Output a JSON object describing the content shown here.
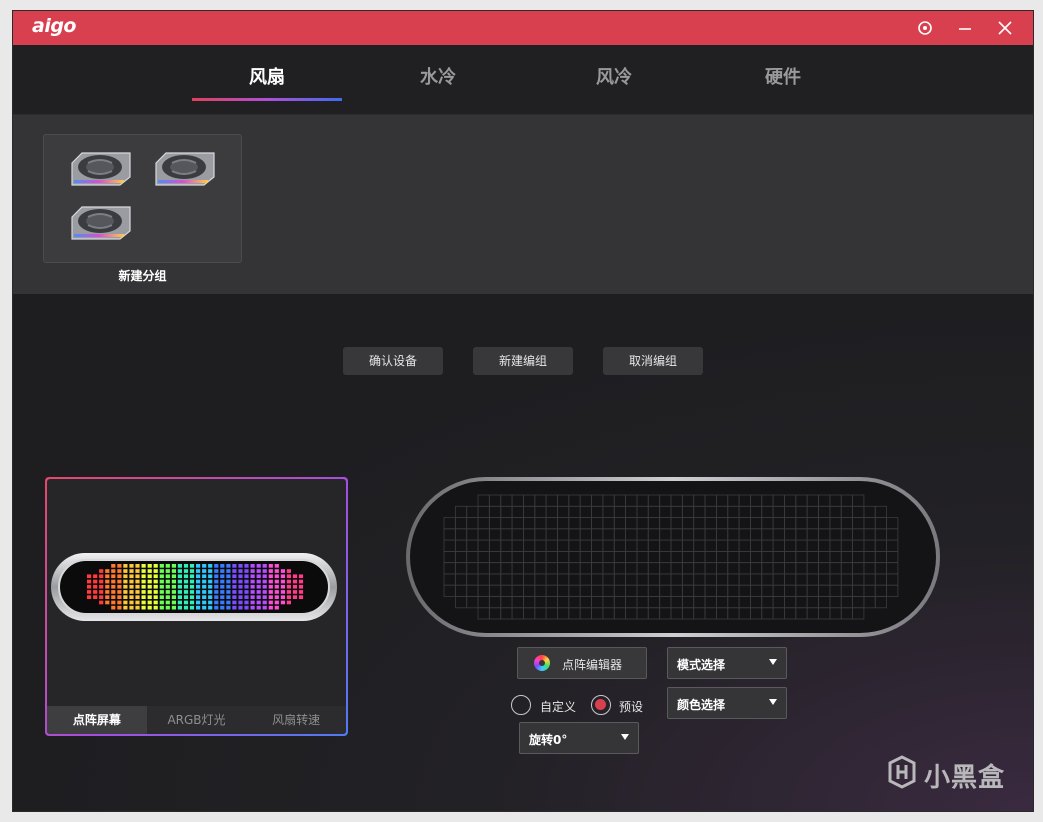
{
  "app": {
    "logo_text": "aigo",
    "accent_color": "#d9404f",
    "titlebar_buttons": [
      "settings-icon",
      "minimize-icon",
      "close-icon"
    ]
  },
  "nav": {
    "tabs": [
      {
        "label": "风扇",
        "active": true
      },
      {
        "label": "水冷",
        "active": false
      },
      {
        "label": "风冷",
        "active": false
      },
      {
        "label": "硬件",
        "active": false
      }
    ]
  },
  "group": {
    "label": "新建分组",
    "fan_count": 3
  },
  "actions": {
    "confirm": "确认设备",
    "new_group": "新建编组",
    "cancel_group": "取消编组"
  },
  "device_tabs": [
    {
      "label": "点阵屏幕",
      "active": true
    },
    {
      "label": "ARGB灯光",
      "active": false
    },
    {
      "label": "风扇转速",
      "active": false
    }
  ],
  "controls": {
    "matrix_editor": "点阵编辑器",
    "mode_select": "模式选择",
    "color_select": "颜色选择",
    "radio_custom": "自定义",
    "radio_preset": "预设",
    "preset_selected": "预设",
    "rotate_select": "旋转0°"
  },
  "watermark": "小黑盒"
}
